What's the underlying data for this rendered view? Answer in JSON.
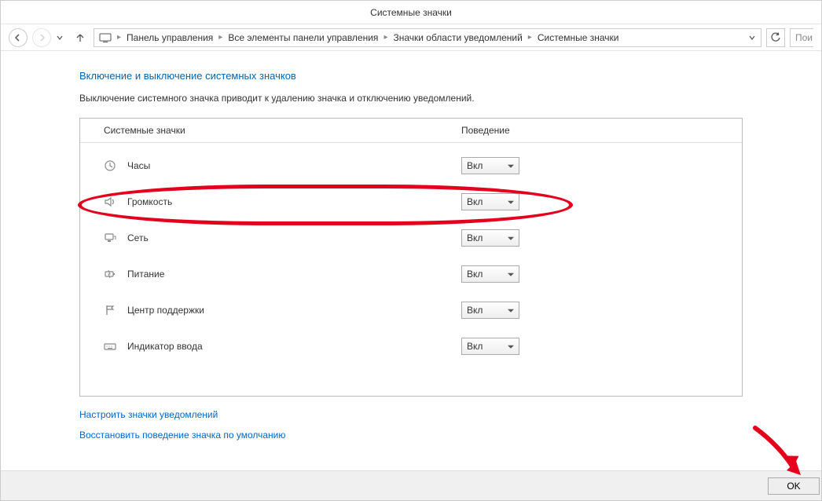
{
  "window": {
    "title": "Системные значки"
  },
  "nav": {
    "breadcrumbs": [
      "Панель управления",
      "Все элементы панели управления",
      "Значки области уведомлений",
      "Системные значки"
    ],
    "search_placeholder": "Пои"
  },
  "page": {
    "heading": "Включение и выключение системных значков",
    "subtext": "Выключение системного значка приводит к удалению значка и отключению уведомлений."
  },
  "table": {
    "col_icons": "Системные значки",
    "col_behavior": "Поведение",
    "rows": [
      {
        "icon": "clock-icon",
        "label": "Часы",
        "value": "Вкл"
      },
      {
        "icon": "volume-icon",
        "label": "Громкость",
        "value": "Вкл"
      },
      {
        "icon": "network-icon",
        "label": "Сеть",
        "value": "Вкл"
      },
      {
        "icon": "power-icon",
        "label": "Питание",
        "value": "Вкл"
      },
      {
        "icon": "flag-icon",
        "label": "Центр поддержки",
        "value": "Вкл"
      },
      {
        "icon": "keyboard-icon",
        "label": "Индикатор ввода",
        "value": "Вкл"
      }
    ]
  },
  "links": {
    "customize": "Настроить значки уведомлений",
    "restore": "Восстановить поведение значка по умолчанию"
  },
  "buttons": {
    "ok": "OK"
  }
}
